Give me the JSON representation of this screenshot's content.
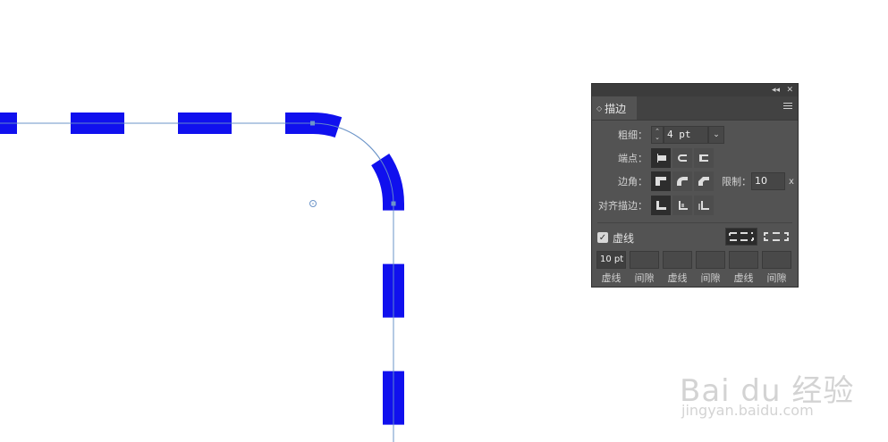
{
  "canvas": {
    "dash_color": "#1010ee",
    "path_color": "#6c94c8"
  },
  "panel": {
    "tab_title": "描边",
    "weight": {
      "label": "粗细：",
      "value": "4 pt"
    },
    "cap": {
      "label": "端点："
    },
    "corner": {
      "label": "边角：",
      "limit_label": "限制：",
      "limit_value": "10",
      "limit_unit": "x"
    },
    "align": {
      "label": "对齐描边："
    },
    "dashed": {
      "label": "虚线",
      "checked": true,
      "fields": [
        {
          "value": "10 pt",
          "label": "虚线"
        },
        {
          "value": "",
          "label": "间隙"
        },
        {
          "value": "",
          "label": "虚线"
        },
        {
          "value": "",
          "label": "间隙"
        },
        {
          "value": "",
          "label": "虚线"
        },
        {
          "value": "",
          "label": "间隙"
        }
      ]
    }
  },
  "watermark": {
    "main": "Bai du 经验",
    "sub": "jingyan.baidu.com"
  }
}
